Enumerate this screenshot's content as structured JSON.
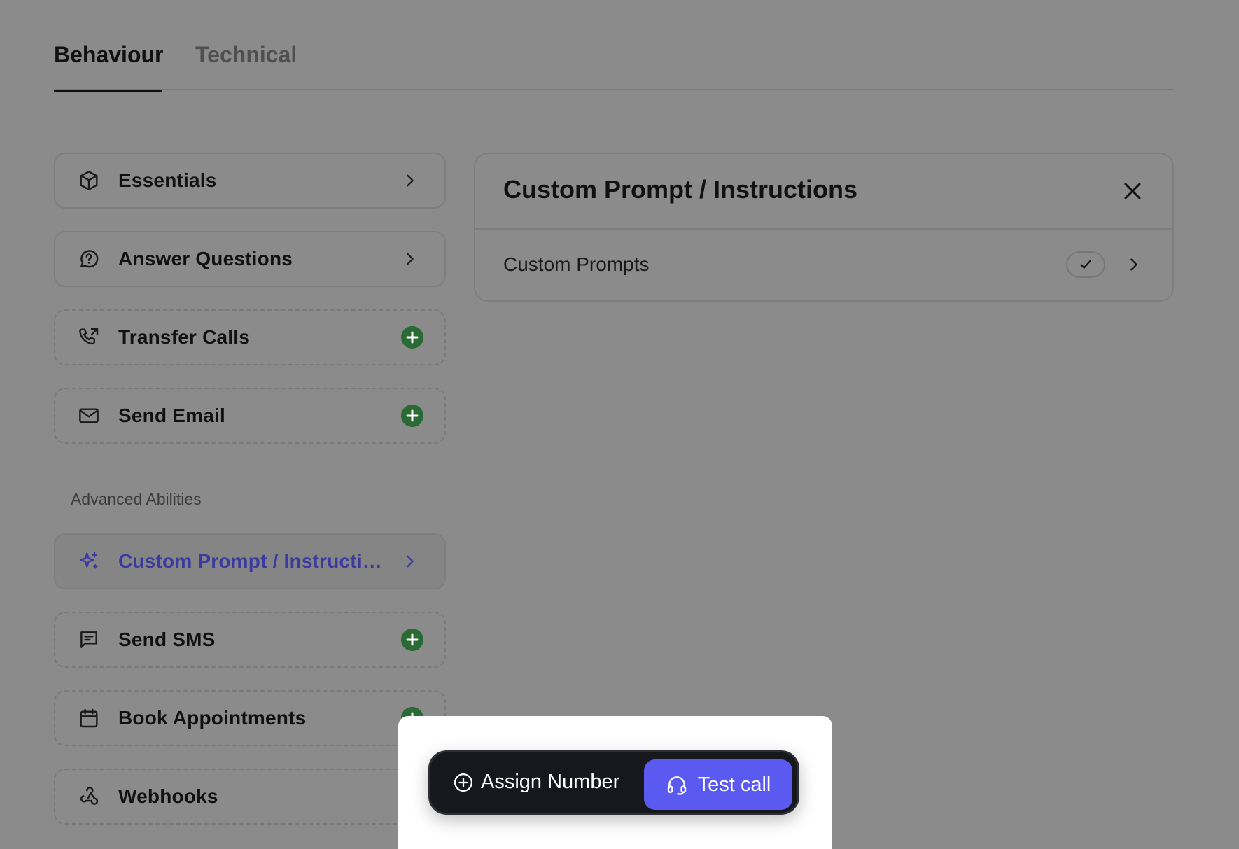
{
  "tabs": {
    "behaviour": "Behaviour",
    "technical": "Technical"
  },
  "abilities": [
    {
      "label": "Essentials",
      "icon": "box-icon",
      "action": "chevron"
    },
    {
      "label": "Answer Questions",
      "icon": "message-question-icon",
      "action": "chevron"
    },
    {
      "label": "Transfer Calls",
      "icon": "phone-forward-icon",
      "action": "add"
    },
    {
      "label": "Send Email",
      "icon": "mail-icon",
      "action": "add"
    }
  ],
  "advanced": {
    "section_label": "Advanced Abilities",
    "items": [
      {
        "label": "Custom Prompt / Instructi…",
        "icon": "sparkles-icon",
        "action": "chevron",
        "selected": true
      },
      {
        "label": "Send SMS",
        "icon": "message-square-icon",
        "action": "add"
      },
      {
        "label": "Book Appointments",
        "icon": "calendar-icon",
        "action": "add"
      },
      {
        "label": "Webhooks",
        "icon": "webhook-icon",
        "action": "add"
      }
    ]
  },
  "panel": {
    "title": "Custom Prompt / Instructions",
    "row_label": "Custom Prompts"
  },
  "bottom_bar": {
    "assign_label": "Assign Number",
    "test_call_label": "Test call"
  },
  "colors": {
    "accent": "#5a5af0",
    "add_green": "#2a6a35",
    "selected_text": "#3a3aa0"
  }
}
